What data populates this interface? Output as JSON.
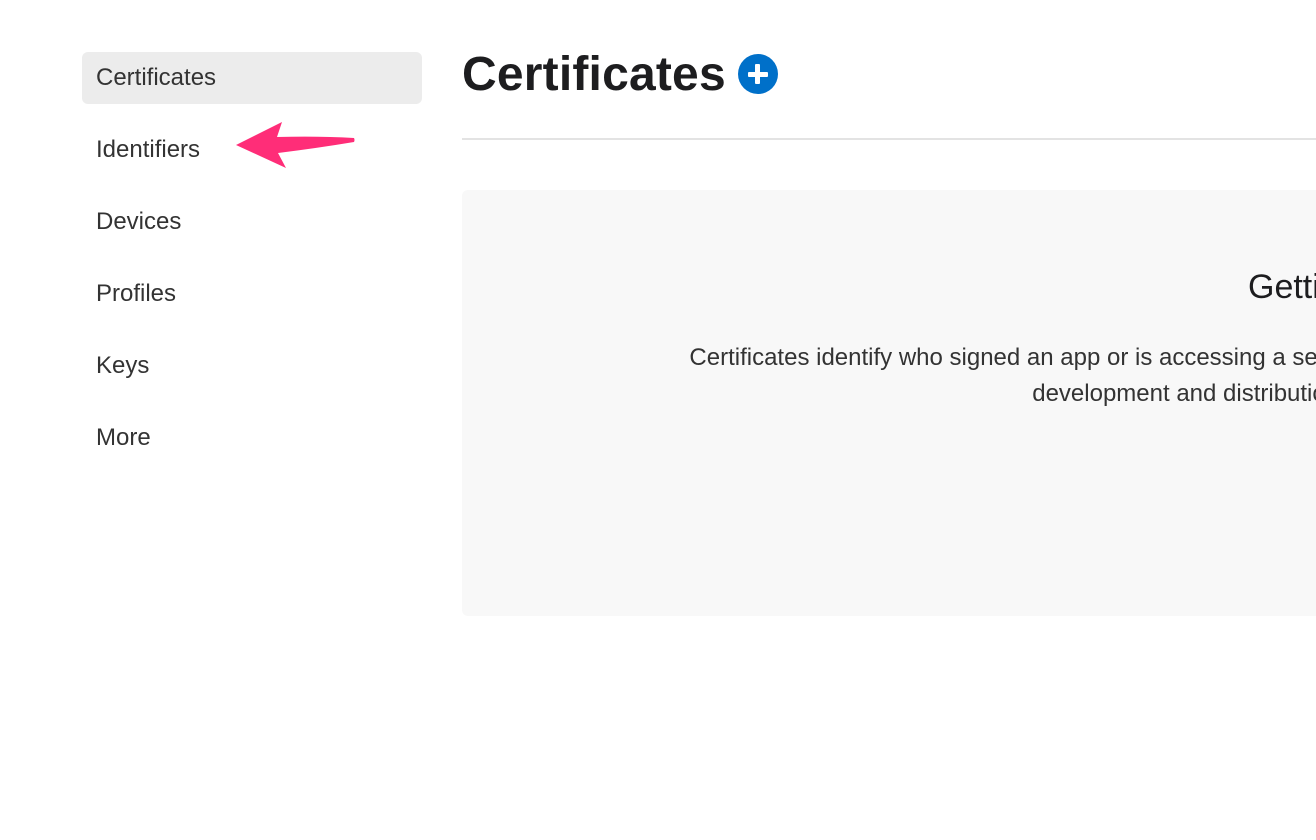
{
  "sidebar": {
    "items": [
      {
        "label": "Certificates"
      },
      {
        "label": "Identifiers"
      },
      {
        "label": "Devices"
      },
      {
        "label": "Profiles"
      },
      {
        "label": "Keys"
      },
      {
        "label": "More"
      }
    ]
  },
  "header": {
    "title": "Certificates",
    "add_icon": "plus-circle-icon"
  },
  "empty_state": {
    "heading": "Getting Started with Certificates",
    "description": "Certificates identify who signed an app or is accessing a service. Create a certificate to enable development and distribution."
  },
  "annotation": {
    "icon": "arrow-left-icon",
    "color": "#ff2d78"
  },
  "colors": {
    "accent": "#0070c9",
    "active_bg": "#ececec",
    "panel_bg": "#f8f8f8"
  }
}
